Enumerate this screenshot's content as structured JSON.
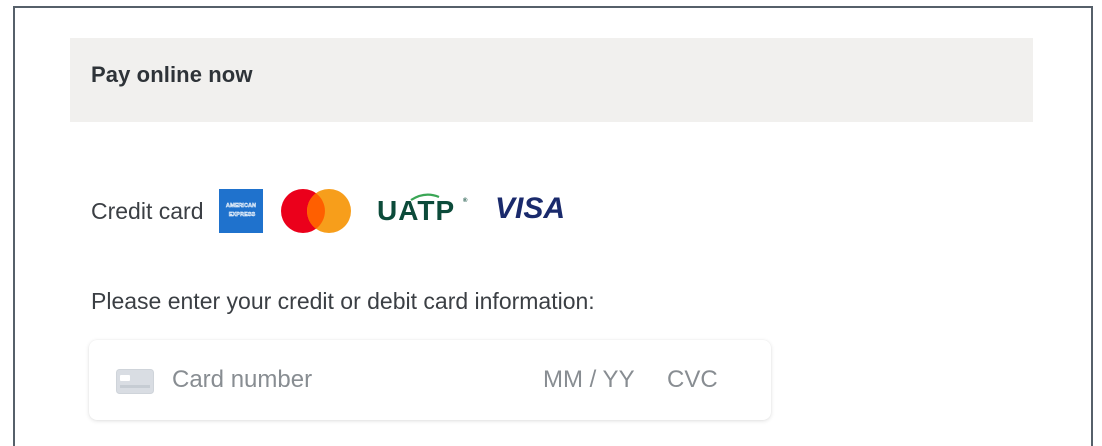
{
  "section": {
    "title": "Pay online now"
  },
  "payment_method": {
    "label": "Credit card",
    "logos": [
      {
        "icon": "amex-logo-icon",
        "text": "AMERICAN EXPRESS",
        "color": "#1f72cd"
      },
      {
        "icon": "mastercard-logo-icon",
        "colors": [
          "#eb001b",
          "#f79e1b"
        ]
      },
      {
        "icon": "uatp-logo-icon",
        "text": "UATP",
        "color": "#0c4b3a"
      },
      {
        "icon": "visa-logo-icon",
        "text": "VISA",
        "color": "#1a2a6c"
      }
    ]
  },
  "instruction": "Please enter your credit or debit card information:",
  "card_form": {
    "card_number_placeholder": "Card number",
    "expiry_placeholder": "MM / YY",
    "cvc_placeholder": "CVC",
    "card_icon": "credit-card-icon"
  }
}
